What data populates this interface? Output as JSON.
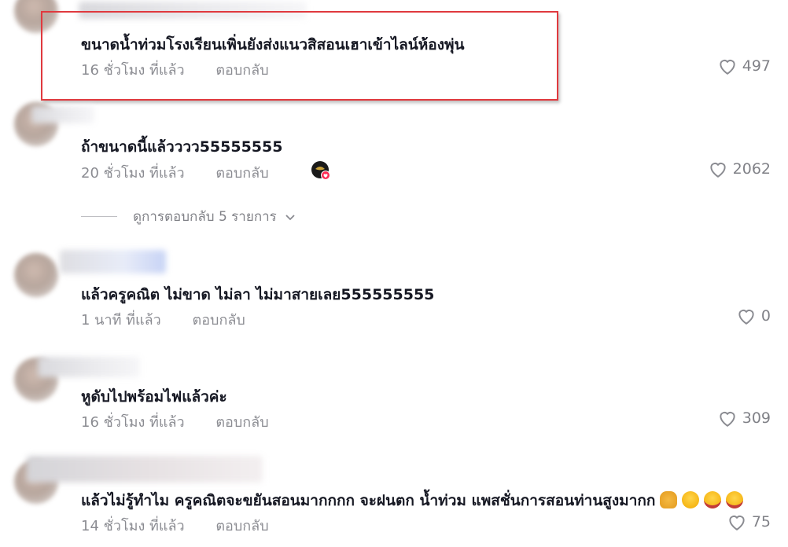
{
  "comments": [
    {
      "text": "ขนาดน้ำท่วมโรงเรียนเพิ่นยังส่งแนวสิสอนเฮาเข้าไลน์ห้องพุ่น",
      "time": "16 ชั่วโมง ที่แล้ว",
      "reply": "ตอบกลับ",
      "likes": "497"
    },
    {
      "text": "ถ้าขนาดนี้แล้วววว55555555",
      "time": "20 ชั่วโมง ที่แล้ว",
      "reply": "ตอบกลับ",
      "likes": "2062"
    },
    {
      "text": "แล้วครูคณิต ไม่ขาด ไม่ลา ไม่มาสายเลย555555555",
      "time": "1 นาที ที่แล้ว",
      "reply": "ตอบกลับ",
      "likes": "0"
    },
    {
      "text": "หูดับไปพร้อมไฟแล้วค่ะ",
      "time": "16 ชั่วโมง ที่แล้ว",
      "reply": "ตอบกลับ",
      "likes": "309"
    },
    {
      "text": "แล้วไม่รู้ทำไม ครูคณิตจะขยันสอนมากกกก จะฝนตก น้ำท่วม แพสชั่นการสอนท่านสูงมากก",
      "time": "14 ชั่วโมง ที่แล้ว",
      "reply": "ตอบกลับ",
      "likes": "75"
    }
  ],
  "view_replies": "ดูการตอบกลับ 5 รายการ",
  "icons": {
    "like": "heart-outline-icon",
    "chevron": "chevron-down-icon"
  },
  "emojis": [
    "folded-hands-emoji",
    "hand-over-mouth-emoji",
    "tears-of-joy-emoji",
    "tears-of-joy-emoji"
  ],
  "colors": {
    "highlight": "#e0393e",
    "liked_badge": "#fe2c55"
  }
}
